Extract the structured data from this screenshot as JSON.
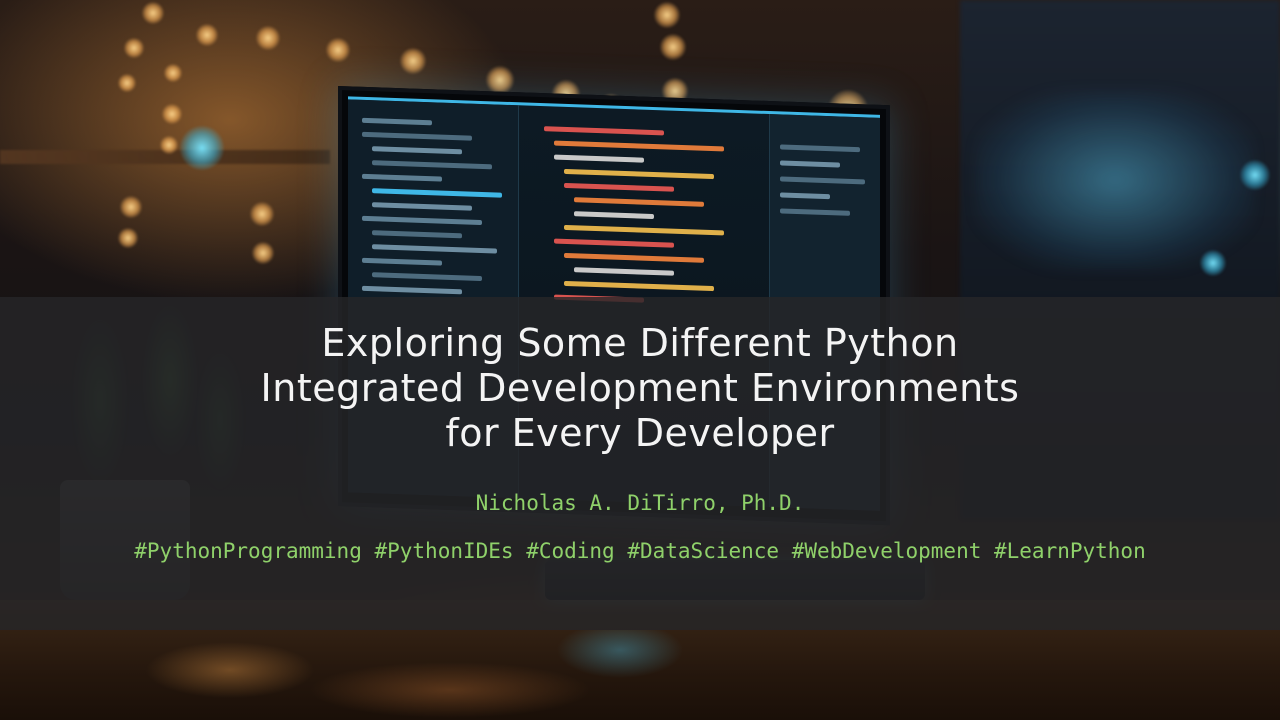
{
  "slide": {
    "title": "Exploring Some Different Python\nIntegrated Development Environments\nfor Every Developer",
    "author": "Nicholas A. DiTirro, Ph.D.",
    "hashtags": "#PythonProgramming #PythonIDEs #Coding #DataScience #WebDevelopment #LearnPython"
  },
  "colors": {
    "title_text": "#f4f4f4",
    "accent_green": "#8fd16a",
    "overlay_band": "#262628"
  }
}
